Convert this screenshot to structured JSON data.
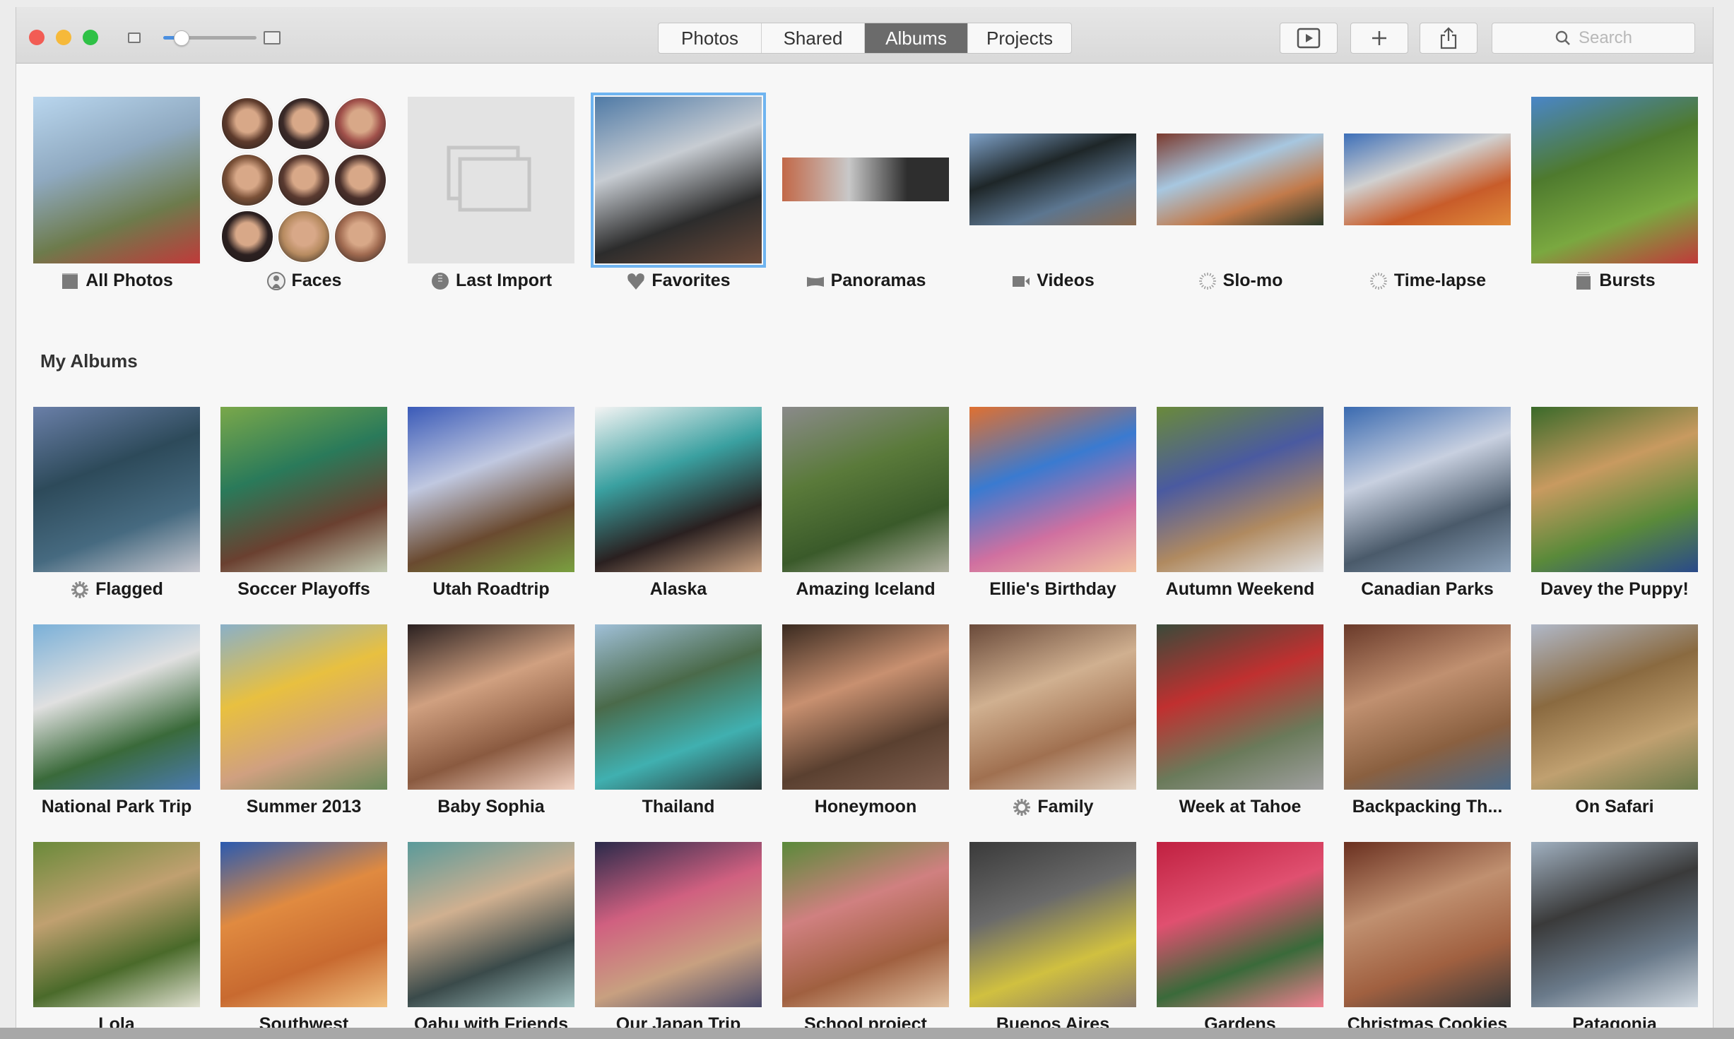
{
  "window": {
    "traffic_lights": [
      {
        "name": "close",
        "color": "#f25c54"
      },
      {
        "name": "minimize",
        "color": "#f6b93a"
      },
      {
        "name": "zoom",
        "color": "#2fc146"
      }
    ],
    "thumbnail_size_slider": {
      "value": 0.1
    }
  },
  "toolbar": {
    "tabs": [
      {
        "label": "Photos",
        "active": false
      },
      {
        "label": "Shared",
        "active": false
      },
      {
        "label": "Albums",
        "active": true
      },
      {
        "label": "Projects",
        "active": false
      }
    ],
    "slideshow_icon": "play-icon",
    "add_icon": "plus-icon",
    "share_icon": "share-icon",
    "search": {
      "placeholder": "Search",
      "icon": "search-icon"
    }
  },
  "smart_albums": [
    {
      "label": "All Photos",
      "icon": "folder-icon",
      "kind": "square",
      "colors": [
        "#b9d6ee",
        "#8fa9c0",
        "#6d7b4c",
        "#c03a3a"
      ]
    },
    {
      "label": "Faces",
      "icon": "person-icon",
      "kind": "faces",
      "colors": [
        "#5e3b2c",
        "#3b2a28",
        "#a0504a",
        "#7b5138",
        "#5a3a30",
        "#4a302b",
        "#2c2020",
        "#b78b60",
        "#a06a50"
      ]
    },
    {
      "label": "Last Import",
      "icon": "import-icon",
      "kind": "empty",
      "colors": [
        "#e3e3e3"
      ]
    },
    {
      "label": "Favorites",
      "icon": "heart-icon",
      "kind": "square",
      "selected": true,
      "colors": [
        "#4f7aa6",
        "#c7ccd2",
        "#2c2c2c",
        "#6b4a3a"
      ]
    },
    {
      "label": "Panoramas",
      "icon": "panorama-icon",
      "kind": "pano",
      "colors": [
        "#c26848",
        "#c8c8c8",
        "#2e2e2e",
        "#5a8fa0"
      ]
    },
    {
      "label": "Videos",
      "icon": "video-icon",
      "kind": "wide",
      "colors": [
        "#7ea1c8",
        "#1e2628",
        "#5c7690",
        "#8a6a50"
      ]
    },
    {
      "label": "Slo-mo",
      "icon": "slomo-icon",
      "kind": "wide",
      "colors": [
        "#7b3a2e",
        "#a7c7e0",
        "#c27a4a",
        "#2c3a2a"
      ]
    },
    {
      "label": "Time-lapse",
      "icon": "timelapse-icon",
      "kind": "wide",
      "colors": [
        "#3d6fb8",
        "#d0d0d0",
        "#c85c2a",
        "#e08a3a"
      ]
    },
    {
      "label": "Bursts",
      "icon": "bursts-icon",
      "kind": "square",
      "colors": [
        "#4a86c8",
        "#4e7a2e",
        "#7aa840",
        "#c03a3a"
      ]
    }
  ],
  "my_albums_title": "My Albums",
  "my_albums": [
    {
      "label": "Flagged",
      "icon": "gear-icon",
      "colors": [
        "#6a7fa8",
        "#2d4a5a",
        "#466a80",
        "#c8c8d0"
      ]
    },
    {
      "label": "Soccer Playoffs",
      "icon": null,
      "colors": [
        "#7aa84a",
        "#2a7a5a",
        "#6a4030",
        "#c0c8b0"
      ]
    },
    {
      "label": "Utah Roadtrip",
      "icon": null,
      "colors": [
        "#3a5ab8",
        "#c0c8e0",
        "#6a4a30",
        "#7aa040"
      ]
    },
    {
      "label": "Alaska",
      "icon": null,
      "colors": [
        "#f4f4f4",
        "#3aa0a0",
        "#2a2020",
        "#c8a080"
      ]
    },
    {
      "label": "Amazing Iceland",
      "icon": null,
      "colors": [
        "#8a8a8a",
        "#5a7a3a",
        "#3a5a2a",
        "#b0b0a0"
      ]
    },
    {
      "label": "Ellie's Birthday",
      "icon": null,
      "colors": [
        "#e07030",
        "#3a7ad0",
        "#d070a0",
        "#f0c0a0"
      ]
    },
    {
      "label": "Autumn Weekend",
      "icon": null,
      "colors": [
        "#6a8a3a",
        "#4a5aa0",
        "#b08a60",
        "#e0e0e0"
      ]
    },
    {
      "label": "Canadian Parks",
      "icon": null,
      "colors": [
        "#3a6ab0",
        "#c8d0e0",
        "#4a5a6a",
        "#8aa0b8"
      ]
    },
    {
      "label": "Davey the Puppy!",
      "icon": null,
      "colors": [
        "#3a6a2a",
        "#c89a60",
        "#5a8a3a",
        "#2a4a8a"
      ]
    },
    {
      "label": "National Park Trip",
      "icon": null,
      "colors": [
        "#7ab0d8",
        "#e0e0e0",
        "#3a6a3a",
        "#4a7ab0"
      ]
    },
    {
      "label": "Summer 2013",
      "icon": null,
      "colors": [
        "#8ab0c8",
        "#e8c040",
        "#d0a080",
        "#6a8a5a"
      ]
    },
    {
      "label": "Baby Sophia",
      "icon": null,
      "colors": [
        "#2a2020",
        "#d0a080",
        "#8a5a40",
        "#f0d0c0"
      ]
    },
    {
      "label": "Thailand",
      "icon": null,
      "colors": [
        "#a0c0d8",
        "#4a6a4a",
        "#40b0b0",
        "#2a3a3a"
      ]
    },
    {
      "label": "Honeymoon",
      "icon": null,
      "colors": [
        "#3a2a20",
        "#c89070",
        "#5a4030",
        "#806050"
      ]
    },
    {
      "label": "Family",
      "icon": "gear-icon",
      "colors": [
        "#6a4a3a",
        "#d0b090",
        "#a07050",
        "#e0d0c0"
      ]
    },
    {
      "label": "Week at Tahoe",
      "icon": null,
      "colors": [
        "#3a4a3a",
        "#c03030",
        "#6a7a5a",
        "#a0a0a0"
      ]
    },
    {
      "label": "Backpacking Th...",
      "icon": null,
      "colors": [
        "#6a3a2a",
        "#c09070",
        "#8a6040",
        "#4a6a8a"
      ]
    },
    {
      "label": "On Safari",
      "icon": null,
      "colors": [
        "#b0b8c8",
        "#8a6a40",
        "#c0a070",
        "#6a7a4a"
      ]
    },
    {
      "label": "Lola",
      "icon": null,
      "colors": [
        "#6a8a3a",
        "#c0a070",
        "#4a6a2a",
        "#e0e0d0"
      ]
    },
    {
      "label": "Southwest",
      "icon": null,
      "colors": [
        "#2a5ab0",
        "#e08a40",
        "#c86a30",
        "#f0c080"
      ]
    },
    {
      "label": "Oahu with Friends",
      "icon": null,
      "colors": [
        "#5a9a9a",
        "#d0b090",
        "#3a4a4a",
        "#a0c0c0"
      ]
    },
    {
      "label": "Our Japan Trip",
      "icon": null,
      "colors": [
        "#2a2a4a",
        "#d06080",
        "#c8a080",
        "#4a4a6a"
      ]
    },
    {
      "label": "School project",
      "icon": null,
      "colors": [
        "#5a8a3a",
        "#d08080",
        "#a06040",
        "#e0c0a0"
      ]
    },
    {
      "label": "Buenos Aires",
      "icon": null,
      "colors": [
        "#3a3a3a",
        "#6a6a6a",
        "#d0c040",
        "#8a7a6a"
      ]
    },
    {
      "label": "Gardens",
      "icon": null,
      "colors": [
        "#c02040",
        "#e05070",
        "#3a6a3a",
        "#f08090"
      ]
    },
    {
      "label": "Christmas Cookies",
      "icon": null,
      "colors": [
        "#6a3020",
        "#c09070",
        "#a06040",
        "#3a3a3a"
      ]
    },
    {
      "label": "Patagonia",
      "icon": null,
      "colors": [
        "#a0b0c0",
        "#3a3a3a",
        "#6a7a8a",
        "#d0d8e0"
      ]
    }
  ]
}
